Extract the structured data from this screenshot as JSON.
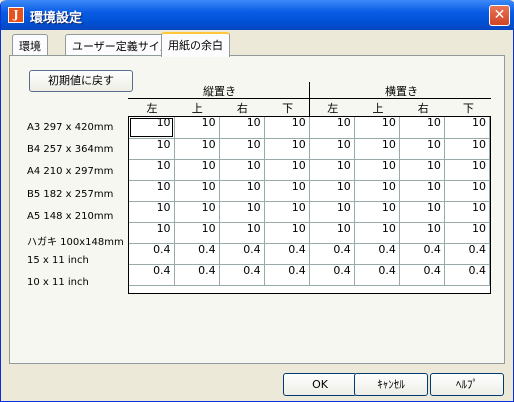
{
  "window": {
    "title": "環境設定",
    "app_icon_text": "J"
  },
  "tabs": [
    {
      "label": "環境"
    },
    {
      "label": "ユーザー定義サイズ"
    },
    {
      "label": "用紙の余白"
    }
  ],
  "panel": {
    "reset_label": "初期値に戻す",
    "group_portrait": "縦置き",
    "group_landscape": "横置き",
    "columns": [
      "左",
      "上",
      "右",
      "下",
      "左",
      "上",
      "右",
      "下"
    ],
    "rows": [
      {
        "label": "A3 297 x 420mm",
        "values": [
          "10",
          "10",
          "10",
          "10",
          "10",
          "10",
          "10",
          "10"
        ]
      },
      {
        "label": "B4 257 x 364mm",
        "values": [
          "10",
          "10",
          "10",
          "10",
          "10",
          "10",
          "10",
          "10"
        ]
      },
      {
        "label": "A4 210 x 297mm",
        "values": [
          "10",
          "10",
          "10",
          "10",
          "10",
          "10",
          "10",
          "10"
        ]
      },
      {
        "label": "B5 182 x 257mm",
        "values": [
          "10",
          "10",
          "10",
          "10",
          "10",
          "10",
          "10",
          "10"
        ]
      },
      {
        "label": "A5 148 x 210mm",
        "values": [
          "10",
          "10",
          "10",
          "10",
          "10",
          "10",
          "10",
          "10"
        ]
      },
      {
        "label": "ハガキ 100x148mm",
        "values": [
          "10",
          "10",
          "10",
          "10",
          "10",
          "10",
          "10",
          "10"
        ]
      },
      {
        "label": "15 x 11 inch",
        "values": [
          "0.4",
          "0.4",
          "0.4",
          "0.4",
          "0.4",
          "0.4",
          "0.4",
          "0.4"
        ]
      },
      {
        "label": "10 x 11 inch",
        "values": [
          "0.4",
          "0.4",
          "0.4",
          "0.4",
          "0.4",
          "0.4",
          "0.4",
          "0.4"
        ]
      }
    ]
  },
  "buttons": {
    "ok": "OK",
    "cancel": "ｷｬﾝｾﾙ",
    "help": "ﾍﾙﾌﾟ"
  }
}
